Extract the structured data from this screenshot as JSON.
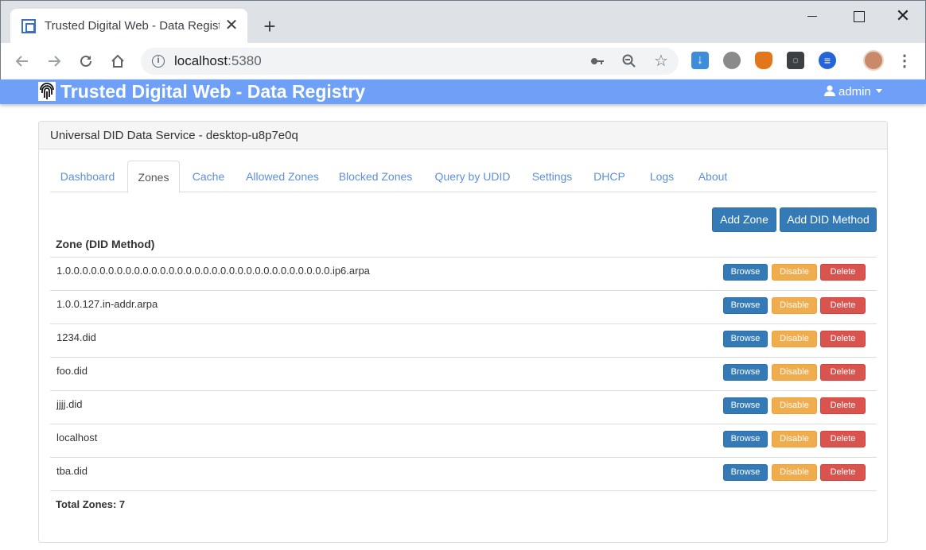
{
  "browser": {
    "tab_title": "Trusted Digital Web - Data Registry",
    "tab_close": "✕",
    "new_tab": "+",
    "close_window": "✕",
    "url_host": "localhost",
    "url_port": ":5380",
    "icons": {
      "back": "arrow-left-icon",
      "forward": "arrow-right-icon",
      "reload": "reload-icon",
      "home": "home-icon",
      "info": "info-icon",
      "key": "key-icon",
      "zoom": "zoom-out-icon",
      "star": "star-icon",
      "menu": "more-vertical-icon"
    }
  },
  "navbar": {
    "brand": "Trusted Digital Web - Data Registry",
    "user": "admin",
    "color": "#6ea0f7"
  },
  "panel": {
    "title": "Universal DID Data Service - desktop-u8p7e0q"
  },
  "tabs": [
    {
      "label": "Dashboard",
      "active": false
    },
    {
      "label": "Zones",
      "active": true
    },
    {
      "label": "Cache",
      "active": false
    },
    {
      "label": "Allowed Zones",
      "active": false
    },
    {
      "label": "Blocked Zones",
      "active": false
    },
    {
      "label": "Query by UDID",
      "active": false
    },
    {
      "label": "Settings",
      "active": false
    },
    {
      "label": "DHCP",
      "active": false
    },
    {
      "label": "Logs",
      "active": false
    },
    {
      "label": "About",
      "active": false
    }
  ],
  "actions": {
    "add_zone": "Add Zone",
    "add_did_method": "Add DID Method"
  },
  "table": {
    "header": "Zone (DID Method)",
    "row_actions": {
      "browse": "Browse",
      "disable": "Disable",
      "delete": "Delete"
    },
    "rows": [
      "1.0.0.0.0.0.0.0.0.0.0.0.0.0.0.0.0.0.0.0.0.0.0.0.0.0.0.0.0.0.0.0.ip6.arpa",
      "1.0.0.127.in-addr.arpa",
      "1234.did",
      "foo.did",
      "jjjj.did",
      "localhost",
      "tba.did"
    ],
    "total": "Total Zones: 7"
  },
  "colors": {
    "primary": "#337ab7",
    "warning": "#f0ad4e",
    "danger": "#d9534f",
    "link": "#5b8fd9"
  }
}
